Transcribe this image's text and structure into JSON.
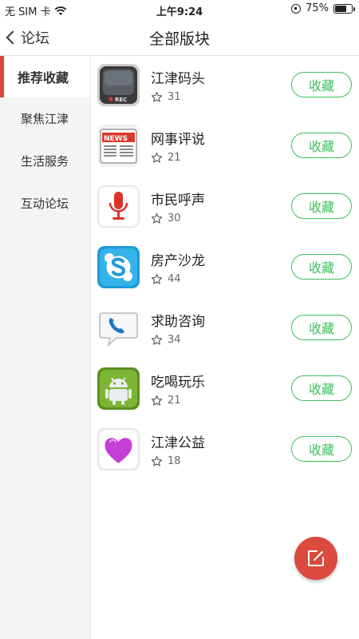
{
  "status_bar": {
    "carrier": "无 SIM 卡",
    "time": "上午9:24",
    "battery_text": "75%",
    "battery_level": 0.75
  },
  "nav": {
    "back_label": "论坛",
    "title": "全部版块"
  },
  "sidebar": {
    "items": [
      {
        "label": "推荐收藏",
        "active": true
      },
      {
        "label": "聚焦江津",
        "active": false
      },
      {
        "label": "生活服务",
        "active": false
      },
      {
        "label": "互动论坛",
        "active": false
      }
    ]
  },
  "boards": [
    {
      "name": "江津码头",
      "count": "31",
      "icon": "rec-tv-icon",
      "button": "收藏"
    },
    {
      "name": "网事评说",
      "count": "21",
      "icon": "newspaper-icon",
      "button": "收藏"
    },
    {
      "name": "市民呼声",
      "count": "30",
      "icon": "microphone-icon",
      "button": "收藏"
    },
    {
      "name": "房产沙龙",
      "count": "44",
      "icon": "skype-icon",
      "button": "收藏"
    },
    {
      "name": "求助咨询",
      "count": "34",
      "icon": "phone-bubble-icon",
      "button": "收藏"
    },
    {
      "name": "吃喝玩乐",
      "count": "21",
      "icon": "android-icon",
      "button": "收藏"
    },
    {
      "name": "江津公益",
      "count": "18",
      "icon": "heart-icon",
      "button": "收藏"
    }
  ],
  "icon_texts": {
    "rec": "REC",
    "news": "NEWS"
  },
  "colors": {
    "accent_red": "#dc4a3e",
    "button_green": "#3cbf5b",
    "sidebar_bg": "#f4f4f4"
  }
}
